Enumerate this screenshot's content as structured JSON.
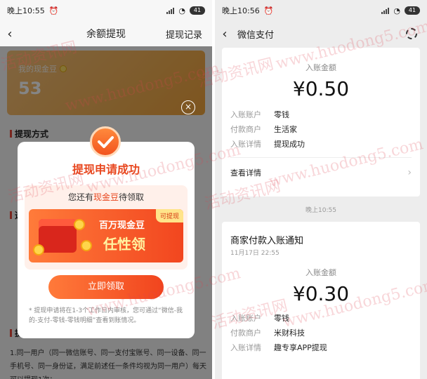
{
  "left": {
    "status": {
      "time": "晚上10:55",
      "battery": "41"
    },
    "nav": {
      "back": "‹",
      "title": "余额提现",
      "link": "提现记录"
    },
    "balance_card": {
      "label": "我的现金豆",
      "value": "53"
    },
    "sections": {
      "method": "提现方式",
      "choose": "选",
      "rules": "提"
    },
    "rule_text": "1.同一用户（同一微信账号、同一支付宝账号、同一设备、同一手机号、同一身份证，满足前述任一条件均视为同一用户）每天可以提现1次；",
    "close_icon": "×",
    "dialog": {
      "title": "提现申请成功",
      "subtitle_prefix": "您还有",
      "subtitle_highlight": "现金豆",
      "subtitle_suffix": "待领取",
      "banner_line1": "百万现金豆",
      "banner_line2": "任性领",
      "banner_tag": "可提现",
      "claim_button": "立即领取",
      "note": "* 提现申请将在1-3个工作日内审核，您可通过“微信-我的-支付-零钱-零钱明细”查看到账情况。"
    }
  },
  "right": {
    "status": {
      "time": "晚上10:56",
      "battery": "41"
    },
    "nav": {
      "back": "‹",
      "title": "微信支付"
    },
    "card1": {
      "amount_label": "入账金额",
      "amount": "¥0.50",
      "rows": [
        {
          "k": "入账账户",
          "v": "零钱"
        },
        {
          "k": "付款商户",
          "v": "生活家"
        },
        {
          "k": "入账详情",
          "v": "提现成功"
        }
      ],
      "more": "查看详情",
      "chevron": "›"
    },
    "time_separator": "晚上10:55",
    "card2": {
      "heading": "商家付款入账通知",
      "date": "11月17日 22:55",
      "amount_label": "入账金额",
      "amount": "¥0.30",
      "rows": [
        {
          "k": "入账账户",
          "v": "零钱"
        },
        {
          "k": "付款商户",
          "v": "米财科技"
        },
        {
          "k": "入账详情",
          "v": "趣专享APP提现"
        }
      ]
    }
  },
  "watermark": {
    "text1": "www.huodong5.com",
    "text2": "活动资讯网"
  },
  "colors": {
    "accent": "#e8471f",
    "wechat_bg": "#ededed"
  }
}
